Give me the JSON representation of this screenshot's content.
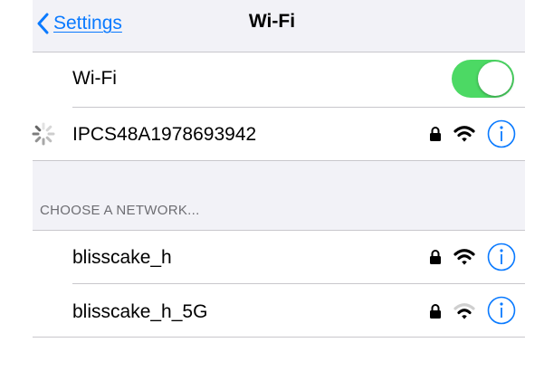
{
  "nav": {
    "back_label": "Settings",
    "title": "Wi-Fi"
  },
  "wifi_toggle": {
    "label": "Wi-Fi",
    "on": true,
    "on_color": "#4cd964"
  },
  "connected_network": {
    "name": "IPCS48A1978693942",
    "secured": true,
    "signal_bars": 3,
    "status": "connecting"
  },
  "networks_section": {
    "header": "CHOOSE A NETWORK...",
    "items": [
      {
        "name": "blisscake_h",
        "secured": true,
        "signal_bars": 3
      },
      {
        "name": "blisscake_h_5G",
        "secured": true,
        "signal_bars": 2
      }
    ]
  },
  "colors": {
    "accent": "#0a7aff",
    "grouped_background": "#f2f2f7",
    "separator": "#c8c7cc",
    "section_header": "#6d6d72"
  },
  "icons": [
    "chevron-left-icon",
    "lock-icon",
    "wifi-icon",
    "info-icon",
    "spinner-icon"
  ]
}
